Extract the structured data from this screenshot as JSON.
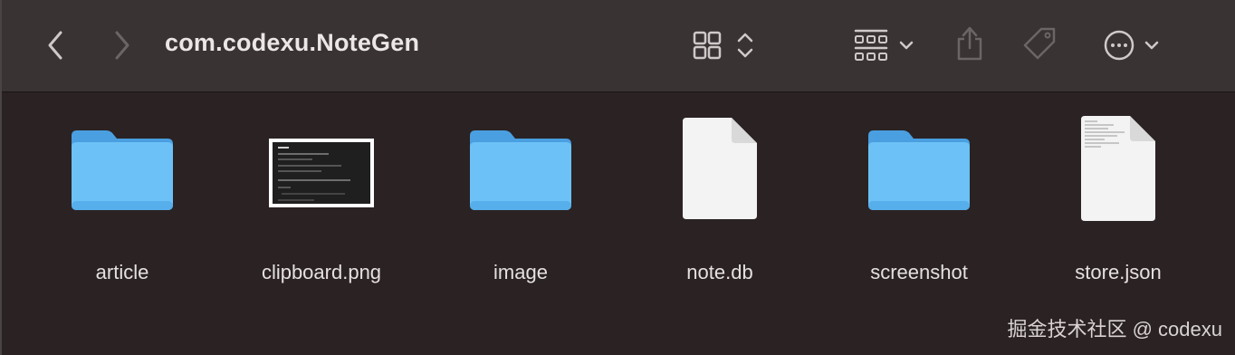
{
  "window": {
    "title": "com.codexu.NoteGen"
  },
  "toolbar": {
    "back": "chevron-left-icon",
    "forward": "chevron-right-icon",
    "view_mode": "grid-view-icon",
    "group": "group-by-icon",
    "share": "share-icon",
    "tag": "tag-icon",
    "more": "more-icon"
  },
  "files": [
    {
      "name": "article",
      "kind": "folder"
    },
    {
      "name": "clipboard.png",
      "kind": "image"
    },
    {
      "name": "image",
      "kind": "folder"
    },
    {
      "name": "note.db",
      "kind": "document"
    },
    {
      "name": "screenshot",
      "kind": "folder"
    },
    {
      "name": "store.json",
      "kind": "document-text"
    }
  ],
  "watermark": "掘金技术社区 @ codexu",
  "colors": {
    "folder": "#6cc1f7",
    "toolbar_bg": "#3a3334",
    "content_bg": "#2a2223"
  }
}
